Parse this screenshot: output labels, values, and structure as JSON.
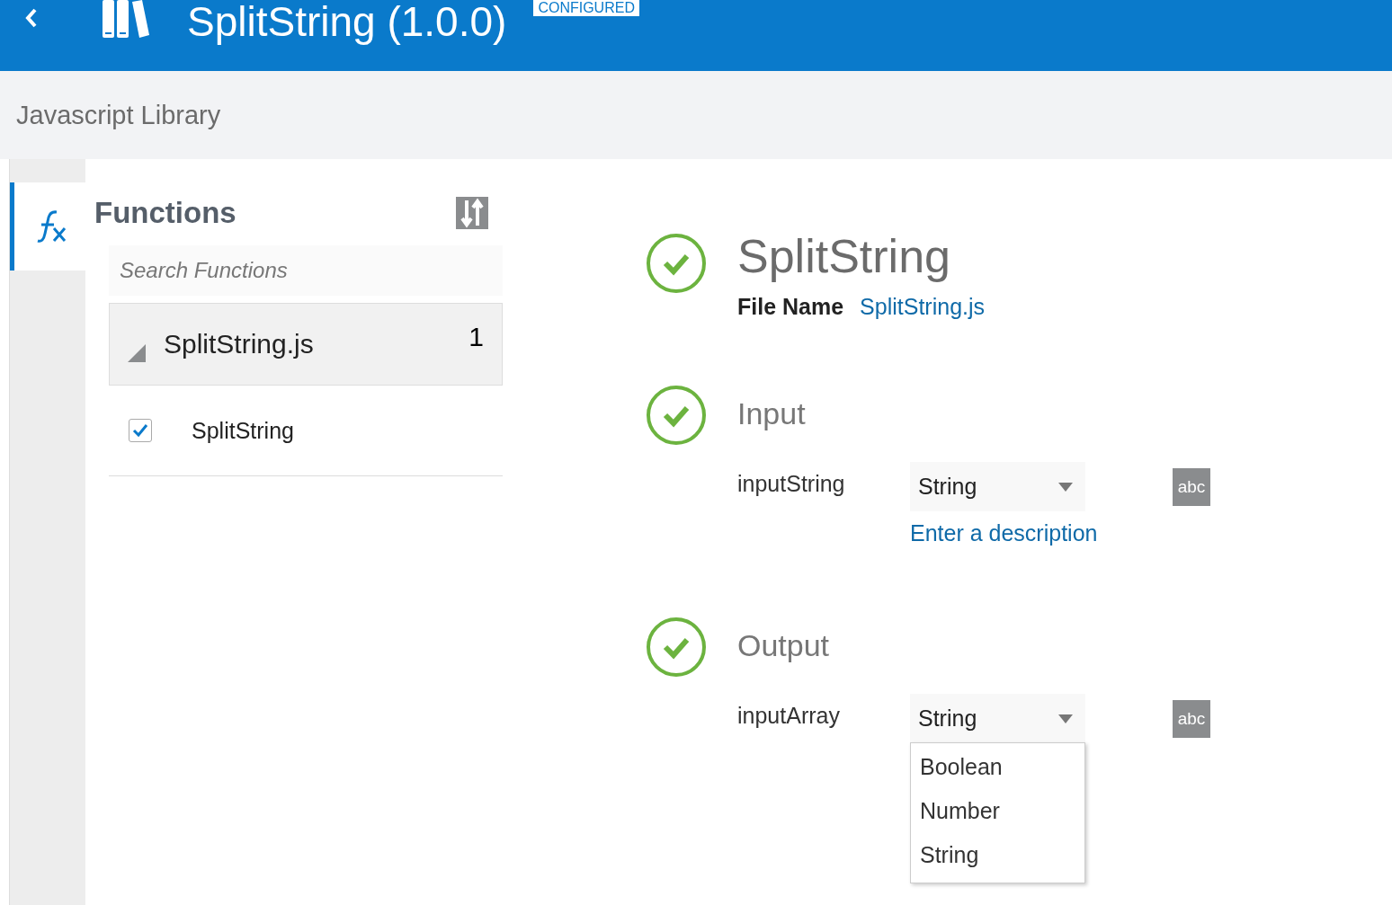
{
  "header": {
    "title": "SplitString (1.0.0)",
    "badge": "CONFIGURED"
  },
  "subtitle": "Javascript Library",
  "nav_tabs": [
    {
      "selected": true
    }
  ],
  "functions_panel": {
    "title": "Functions",
    "search": {
      "placeholder": "Search Functions"
    },
    "groups": [
      {
        "name": "SplitString.js",
        "count": "1",
        "expanded": true,
        "items": [
          {
            "name": "SplitString",
            "checked": true
          }
        ]
      }
    ]
  },
  "detail": {
    "title": "SplitString",
    "complete": true,
    "file_label": "File Name",
    "file_name": "SplitString.js",
    "sections": [
      {
        "heading": "Input",
        "complete": true,
        "params": [
          {
            "name": "inputString",
            "type": "String",
            "description": "Enter a description",
            "badge": "abc"
          }
        ]
      },
      {
        "heading": "Output",
        "complete": true,
        "params": [
          {
            "name": "inputArray",
            "type": "String",
            "badge": "abc",
            "options": [
              "Boolean",
              "Number",
              "String"
            ]
          }
        ]
      }
    ]
  }
}
